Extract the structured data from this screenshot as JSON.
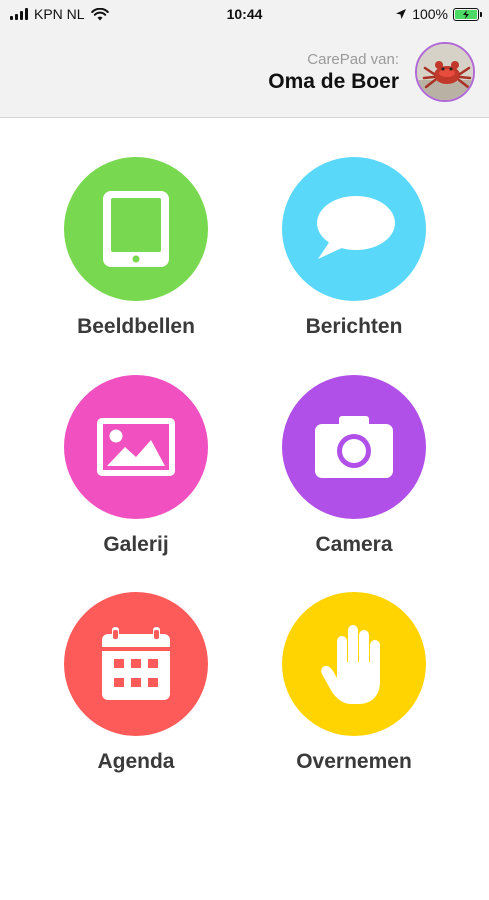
{
  "status_bar": {
    "carrier": "KPN NL",
    "time": "10:44",
    "battery": "100%",
    "icons": [
      "signal-icon",
      "wifi-icon",
      "location-icon",
      "battery-icon"
    ]
  },
  "header": {
    "subtitle": "CarePad van:",
    "name": "Oma de Boer",
    "avatar_border_color": "#b06ad6"
  },
  "tiles": [
    {
      "label": "Beeldbellen",
      "icon": "tablet-icon",
      "color": "#78d850"
    },
    {
      "label": "Berichten",
      "icon": "speech-bubble-icon",
      "color": "#5ad8fa"
    },
    {
      "label": "Galerij",
      "icon": "picture-icon",
      "color": "#f050c0"
    },
    {
      "label": "Camera",
      "icon": "camera-icon",
      "color": "#b050e8"
    },
    {
      "label": "Agenda",
      "icon": "calendar-icon",
      "color": "#fd5a5a"
    },
    {
      "label": "Overnemen",
      "icon": "hand-icon",
      "color": "#ffd400"
    }
  ]
}
